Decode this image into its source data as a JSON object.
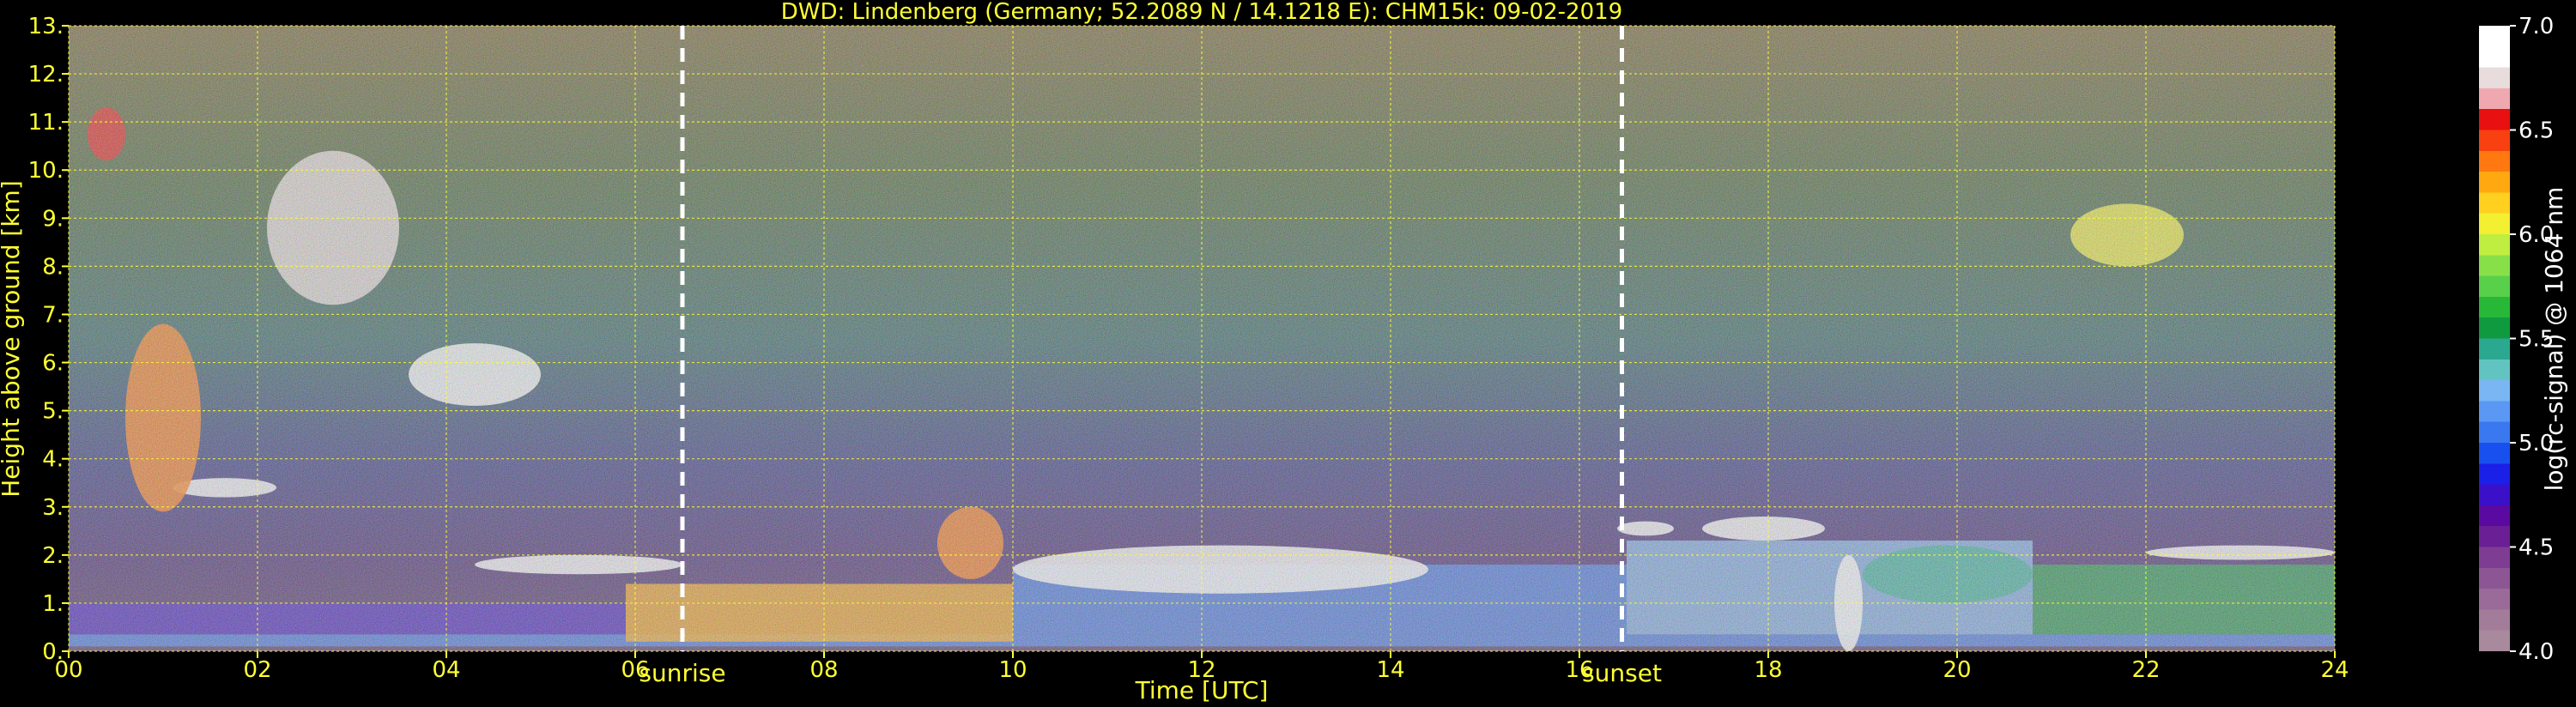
{
  "chart_data": {
    "type": "heatmap",
    "title": "DWD: Lindenberg (Germany; 52.2089 N / 14.1218 E):    CHM15k: 09-02-2019",
    "xlabel": "Time [UTC]",
    "ylabel": "Height above ground [km]",
    "xlim": [
      0,
      24
    ],
    "ylim": [
      0,
      13
    ],
    "x_ticks": [
      0,
      2,
      4,
      6,
      8,
      10,
      12,
      14,
      16,
      18,
      20,
      22,
      24
    ],
    "x_tick_labels": [
      "00",
      "02",
      "04",
      "06",
      "08",
      "10",
      "12",
      "14",
      "16",
      "18",
      "20",
      "22",
      "24"
    ],
    "y_ticks": [
      0,
      1,
      2,
      3,
      4,
      5,
      6,
      7,
      8,
      9,
      10,
      11,
      12,
      13
    ],
    "y_tick_labels": [
      "0.",
      "1.",
      "2.",
      "3.",
      "4.",
      "5.",
      "6.",
      "7.",
      "8.",
      "9.",
      "10.",
      "11.",
      "12.",
      "13."
    ],
    "grid": true,
    "grid_color": "#ffff33",
    "text_color": "#ffff33",
    "events": [
      {
        "label": "sunrise",
        "x": 6.5
      },
      {
        "label": "sunset",
        "x": 16.45
      }
    ],
    "colorbar": {
      "label": "log(rc-signal) @ 1064 nm",
      "range": [
        4.0,
        7.0
      ],
      "tick_values": [
        4.0,
        4.5,
        5.0,
        5.5,
        6.0,
        6.5,
        7.0
      ],
      "tick_labels": [
        "4.0",
        "4.5",
        "5.0",
        "5.5",
        "6.0",
        "6.5",
        "7.0"
      ],
      "colors": [
        "#a88a9c",
        "#a37c9a",
        "#9a6a98",
        "#8c5594",
        "#7e3d92",
        "#6a1f94",
        "#5a0aa0",
        "#3a10c8",
        "#1a20e8",
        "#1850f0",
        "#3a78f0",
        "#5a98f4",
        "#7ab6f2",
        "#62c4c0",
        "#2aa890",
        "#109a40",
        "#28b838",
        "#58d04a",
        "#88e048",
        "#c0ee40",
        "#f2f030",
        "#ffd020",
        "#ffa810",
        "#ff7810",
        "#f84010",
        "#e81010",
        "#f0a8b0",
        "#e8dcdc",
        "#ffffff",
        "#ffffff"
      ]
    },
    "layers": [
      {
        "kind": "band",
        "x": [
          0,
          24
        ],
        "y": [
          0.1,
          0.35
        ],
        "value": 5.0
      },
      {
        "kind": "band",
        "x": [
          0,
          5.9
        ],
        "y": [
          0.35,
          1.0
        ],
        "value": 4.8
      },
      {
        "kind": "band",
        "x": [
          5.9,
          10.0
        ],
        "y": [
          0.2,
          1.4
        ],
        "value": 6.2
      },
      {
        "kind": "band",
        "x": [
          10.0,
          16.5
        ],
        "y": [
          0.35,
          1.8
        ],
        "value": 5.1
      },
      {
        "kind": "band",
        "x": [
          16.5,
          20.8
        ],
        "y": [
          0.35,
          2.3
        ],
        "value": 5.2
      },
      {
        "kind": "band",
        "x": [
          20.8,
          24
        ],
        "y": [
          0.35,
          1.8
        ],
        "value": 5.6
      },
      {
        "kind": "cloud",
        "x": [
          4.3,
          6.5
        ],
        "y": [
          1.6,
          2.0
        ],
        "value": 7.0
      },
      {
        "kind": "cloud",
        "x": [
          10.0,
          14.4
        ],
        "y": [
          1.2,
          2.2
        ],
        "value": 7.0
      },
      {
        "kind": "cloud",
        "x": [
          16.4,
          17.0
        ],
        "y": [
          2.4,
          2.7
        ],
        "value": 7.0
      },
      {
        "kind": "cloud",
        "x": [
          17.3,
          18.6
        ],
        "y": [
          2.3,
          2.8
        ],
        "value": 7.0
      },
      {
        "kind": "cloud",
        "x": [
          22.0,
          24.0
        ],
        "y": [
          1.9,
          2.2
        ],
        "value": 7.0
      },
      {
        "kind": "cloud",
        "x": [
          1.1,
          2.2
        ],
        "y": [
          3.2,
          3.6
        ],
        "value": 7.0
      },
      {
        "kind": "cloud",
        "x": [
          0.6,
          1.4
        ],
        "y": [
          2.9,
          6.8
        ],
        "value": 6.3
      },
      {
        "kind": "cloud",
        "x": [
          2.1,
          3.5
        ],
        "y": [
          7.2,
          10.4
        ],
        "value": 6.8
      },
      {
        "kind": "cloud",
        "x": [
          3.6,
          5.0
        ],
        "y": [
          5.1,
          6.4
        ],
        "value": 7.0
      },
      {
        "kind": "cloud",
        "x": [
          0.2,
          0.6
        ],
        "y": [
          10.2,
          11.3
        ],
        "value": 6.5
      },
      {
        "kind": "cloud",
        "x": [
          18.7,
          19.0
        ],
        "y": [
          0.0,
          2.0
        ],
        "value": 7.0
      },
      {
        "kind": "cloud",
        "x": [
          21.2,
          22.4
        ],
        "y": [
          8.0,
          9.3
        ],
        "value": 6.0
      },
      {
        "kind": "cloud",
        "x": [
          9.2,
          9.9
        ],
        "y": [
          1.5,
          3.0
        ],
        "value": 6.3
      },
      {
        "kind": "cloud",
        "x": [
          19.0,
          20.8
        ],
        "y": [
          1.0,
          2.2
        ],
        "value": 5.4
      }
    ]
  }
}
